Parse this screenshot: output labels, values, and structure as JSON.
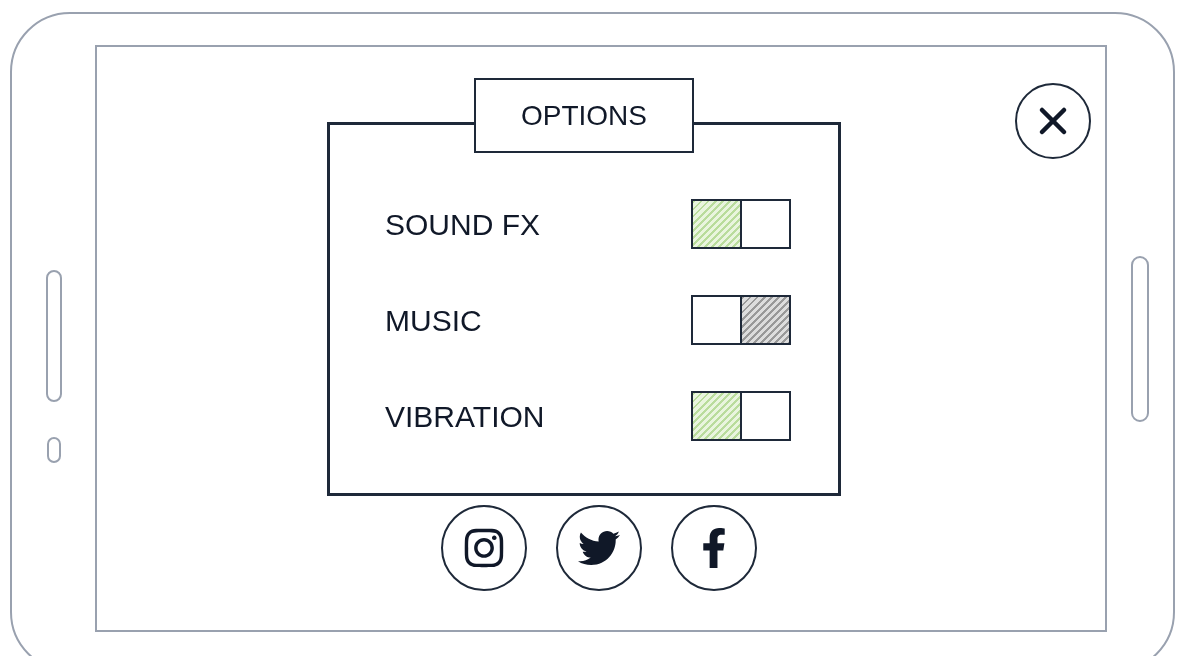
{
  "panel": {
    "title": "OPTIONS"
  },
  "settings": [
    {
      "label": "SOUND FX",
      "on": true
    },
    {
      "label": "MUSIC",
      "on": false
    },
    {
      "label": "VIBRATION",
      "on": true
    }
  ]
}
